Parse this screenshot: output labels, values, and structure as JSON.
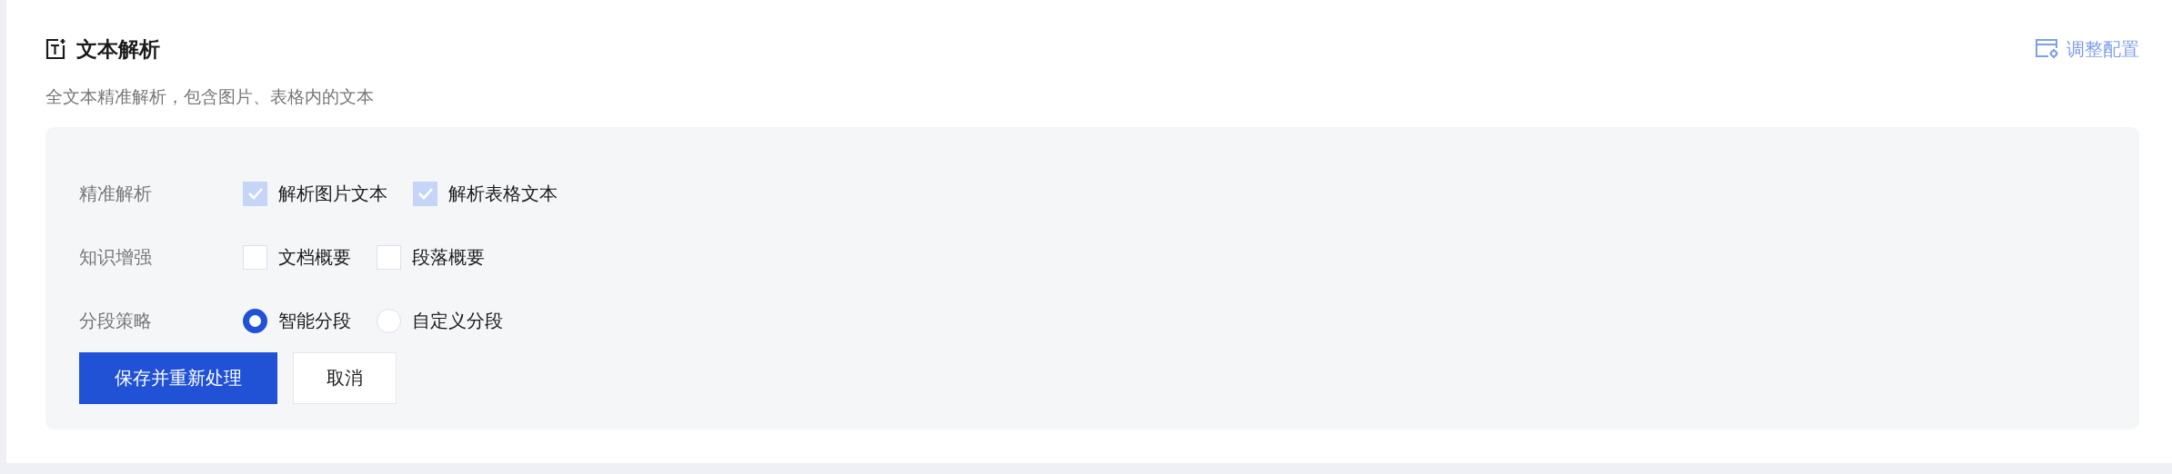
{
  "section": {
    "title": "文本解析",
    "description": "全文本精准解析，包含图片、表格内的文本",
    "config_link": {
      "label": "调整配置",
      "disabled": true
    }
  },
  "settings": [
    {
      "label": "精准解析",
      "options": [
        {
          "kind": "checkbox",
          "label": "解析图片文本",
          "checked": true,
          "disabled": true
        },
        {
          "kind": "checkbox",
          "label": "解析表格文本",
          "checked": true,
          "disabled": true
        }
      ]
    },
    {
      "label": "知识增强",
      "options": [
        {
          "kind": "checkbox",
          "label": "文档概要",
          "checked": false,
          "disabled": false
        },
        {
          "kind": "checkbox",
          "label": "段落概要",
          "checked": false,
          "disabled": false
        }
      ]
    },
    {
      "label": "分段策略",
      "options": [
        {
          "kind": "radio",
          "label": "智能分段",
          "selected": true
        },
        {
          "kind": "radio",
          "label": "自定义分段",
          "selected": false
        }
      ]
    }
  ],
  "buttons": [
    {
      "kind": "primary",
      "label": "保存并重新处理"
    },
    {
      "kind": "default",
      "label": "取消"
    }
  ]
}
